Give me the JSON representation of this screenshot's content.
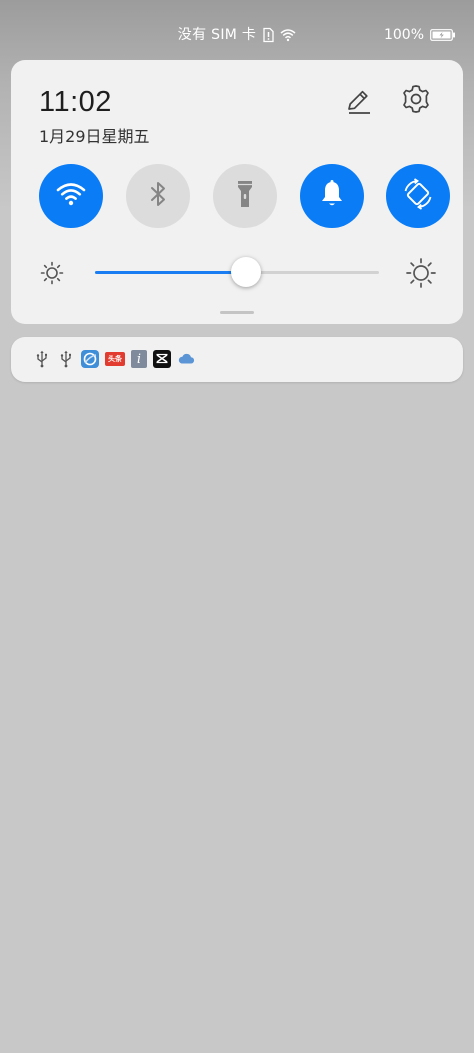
{
  "status_bar": {
    "carrier": "没有 SIM 卡",
    "sim_icon": "sim-card-missing-icon",
    "wifi_icon": "wifi-icon",
    "battery_percent": "100%",
    "battery_icon": "battery-charging-icon"
  },
  "quick_settings": {
    "time": "11:02",
    "date": "1月29日星期五",
    "edit_icon": "pencil-icon",
    "settings_icon": "gear-icon",
    "toggles": [
      {
        "id": "wifi",
        "icon": "wifi-icon",
        "state": "on"
      },
      {
        "id": "bluetooth",
        "icon": "bluetooth-icon",
        "state": "off"
      },
      {
        "id": "flashlight",
        "icon": "flashlight-icon",
        "state": "off"
      },
      {
        "id": "sound",
        "icon": "bell-icon",
        "state": "on"
      },
      {
        "id": "auto-rotate",
        "icon": "rotate-icon",
        "state": "on"
      }
    ],
    "brightness": {
      "level_percent": 53,
      "low_icon": "brightness-low-icon",
      "high_icon": "brightness-high-icon"
    }
  },
  "notifications": {
    "icons": [
      {
        "name": "usb-icon"
      },
      {
        "name": "usb-icon"
      },
      {
        "name": "app-icon"
      },
      {
        "name": "toutiao-icon",
        "label": "头条"
      },
      {
        "name": "info-icon",
        "label": "i"
      },
      {
        "name": "capcut-icon"
      },
      {
        "name": "cloud-icon"
      }
    ]
  },
  "colors": {
    "accent": "#0a7cf6",
    "toggle_off": "#dcdcdc",
    "panel_bg": "#f1f1f1",
    "background": "#c8c8c8"
  }
}
